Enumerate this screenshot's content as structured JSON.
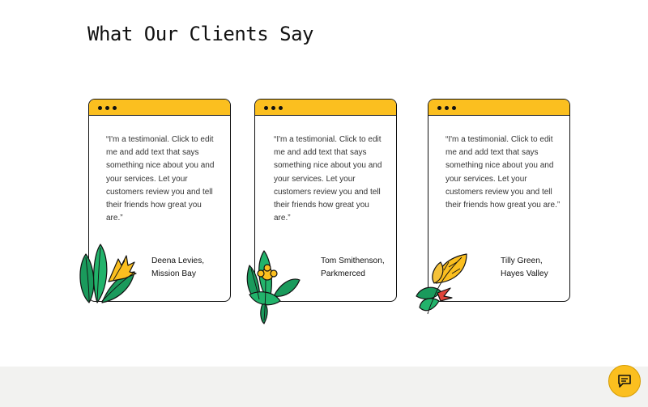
{
  "section": {
    "title": "What Our Clients Say"
  },
  "testimonials": [
    {
      "quote": "“I'm a testimonial. Click to edit me and add text that says something nice about you and your services. Let your customers review you and tell their friends how great you are.”",
      "author_line1": "Deena Levies,",
      "author_line2": "Mission Bay"
    },
    {
      "quote": "“I'm a testimonial. Click to edit me and add text that says something nice about you and your services. Let your customers review you and tell their friends how great you are.”",
      "author_line1": "Tom Smithenson,",
      "author_line2": "Parkmerced"
    },
    {
      "quote": "“I'm a testimonial. Click to edit me and add text that says something nice about you and your services. Let your customers review you and tell their friends how great you are.”",
      "author_line1": "Tilly Green,",
      "author_line2": "Hayes Valley"
    }
  ],
  "colors": {
    "accent": "#fbbf1f",
    "leaf_green": "#1a9a5c",
    "footer_bg": "#f2f2f0"
  },
  "icons": {
    "chat": "chat-icon",
    "window_dots": "window-dots-icon"
  }
}
